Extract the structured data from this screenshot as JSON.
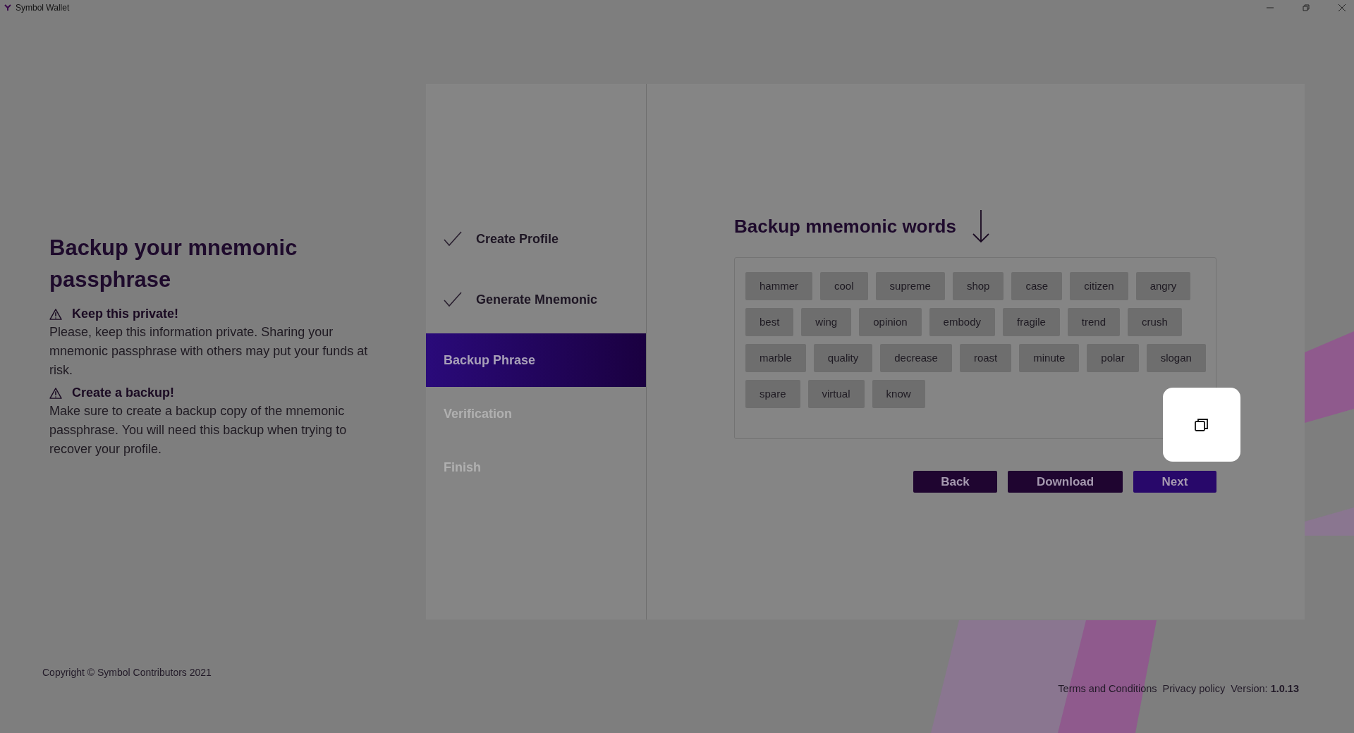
{
  "window": {
    "title": "Symbol Wallet"
  },
  "intro": {
    "title": "Backup your mnemonic passphrase",
    "notices": [
      {
        "heading": "Keep this private!",
        "text": "Please, keep this information private. Sharing your mnemonic passphrase with others may put your funds at risk."
      },
      {
        "heading": "Create a backup!",
        "text": "Make sure to create a backup copy of the mnemonic passphrase. You will need this backup when trying to recover your profile."
      }
    ]
  },
  "steps": [
    {
      "label": "Create Profile",
      "completed": true,
      "selected": false
    },
    {
      "label": "Generate Mnemonic",
      "completed": true,
      "selected": false
    },
    {
      "label": "Backup Phrase",
      "completed": false,
      "selected": true
    },
    {
      "label": "Verification",
      "completed": false,
      "selected": false
    },
    {
      "label": "Finish",
      "completed": false,
      "selected": false
    }
  ],
  "mnemonic": {
    "title": "Backup mnemonic words",
    "words": [
      "hammer",
      "cool",
      "supreme",
      "shop",
      "case",
      "citizen",
      "angry",
      "best",
      "wing",
      "opinion",
      "embody",
      "fragile",
      "trend",
      "crush",
      "marble",
      "quality",
      "decrease",
      "roast",
      "minute",
      "polar",
      "slogan",
      "spare",
      "virtual",
      "know"
    ]
  },
  "buttons": [
    {
      "label": "Back",
      "kind": "dark"
    },
    {
      "label": "Download",
      "kind": "dark"
    },
    {
      "label": "Next",
      "kind": "primary"
    }
  ],
  "footer": {
    "copyright": "Copyright © Symbol Contributors 2021",
    "links": [
      "Terms and Conditions",
      "Privacy policy"
    ],
    "version_label": "Version:",
    "version": "1.0.13"
  }
}
